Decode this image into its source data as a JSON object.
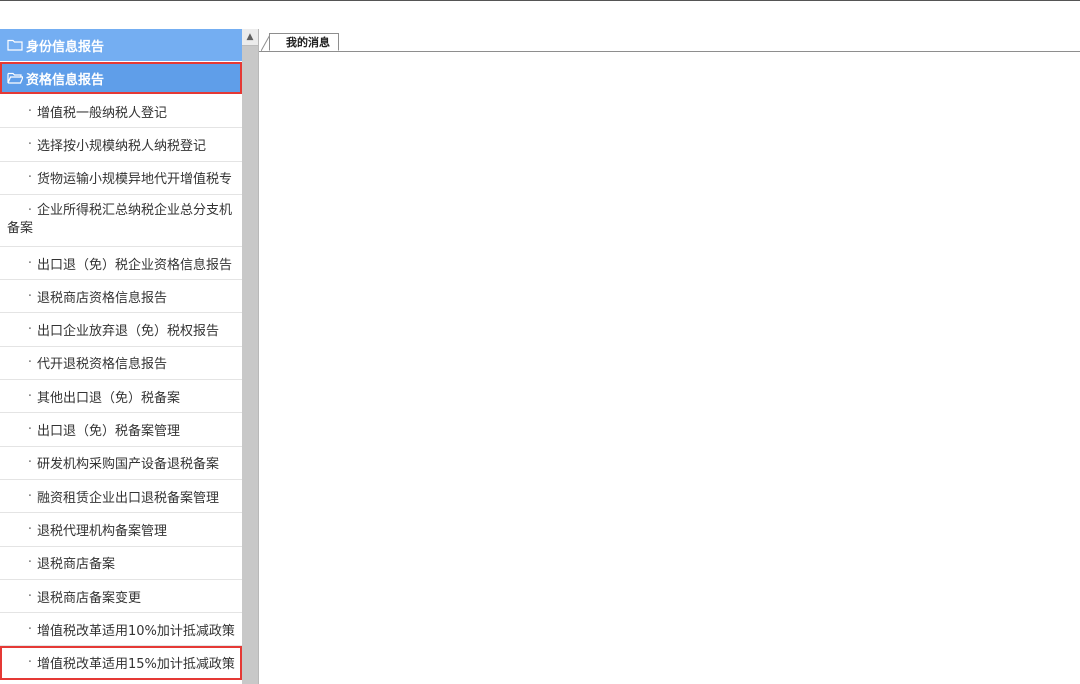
{
  "sidebar": {
    "groups": [
      {
        "label": "身份信息报告",
        "icon": "folder-icon",
        "expanded": false
      },
      {
        "label": "资格信息报告",
        "icon": "folder-open-icon",
        "expanded": true
      }
    ],
    "bullet": "·",
    "items": [
      "增值税一般纳税人登记",
      "选择按小规模纳税人纳税登记",
      "货物运输小规模异地代开增值税专",
      {
        "line1": "企业所得税汇总纳税企业总分支机",
        "line2": "备案"
      },
      "出口退（免）税企业资格信息报告",
      "退税商店资格信息报告",
      "出口企业放弃退（免）税权报告",
      "代开退税资格信息报告",
      "其他出口退（免）税备案",
      "出口退（免）税备案管理",
      "研发机构采购国产设备退税备案",
      "融资租赁企业出口退税备案管理",
      "退税代理机构备案管理",
      "退税商店备案",
      "退税商店备案变更",
      "增值税改革适用10%加计抵减政策",
      "增值税改革适用15%加计抵减政策"
    ]
  },
  "tabs": [
    {
      "label": "我的消息",
      "active": true
    }
  ],
  "colors": {
    "header_blue": "#74aef2",
    "highlight_red": "#e53935"
  }
}
